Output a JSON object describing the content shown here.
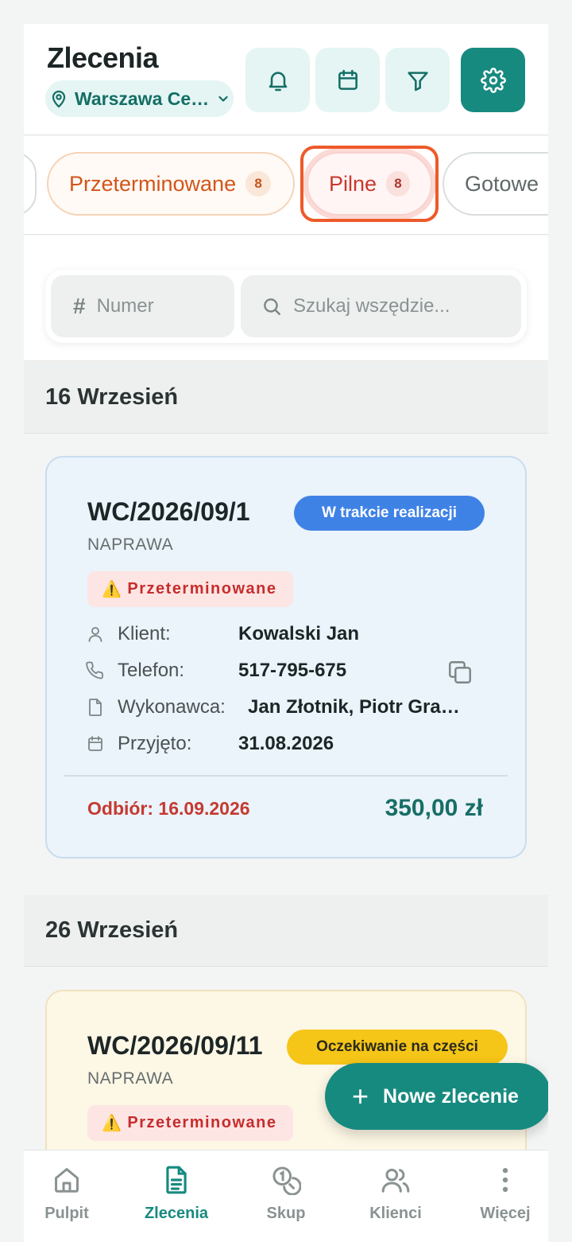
{
  "header": {
    "title": "Zlecenia",
    "location": "Warszawa Ce…",
    "icons": [
      "bell-icon",
      "calendar-icon",
      "filter-icon",
      "gear-icon"
    ]
  },
  "tabs": {
    "overdue": {
      "label": "Przeterminowane",
      "count": "8"
    },
    "urgent": {
      "label": "Pilne",
      "count": "8"
    },
    "ready": {
      "label": "Gotowe"
    }
  },
  "search": {
    "number_placeholder": "Numer",
    "search_placeholder": "Szukaj wszędzie..."
  },
  "groups": [
    {
      "date": "16 Wrzesień",
      "orders": [
        {
          "number": "WC/2026/09/1",
          "type": "NAPRAWA",
          "status": "W trakcie realizacji",
          "flag": "Przeterminowane",
          "client_label": "Klient:",
          "client": "Kowalski Jan",
          "phone_label": "Telefon:",
          "phone": "517-795-675",
          "worker_label": "Wykonawca:",
          "worker": "Jan Złotnik, Piotr Grabowski",
          "received_label": "Przyjęto:",
          "received": "31.08.2026",
          "pickup": "Odbiór: 16.09.2026",
          "price": "350,00 zł"
        }
      ]
    },
    {
      "date": "26 Wrzesień",
      "orders": [
        {
          "number": "WC/2026/09/11",
          "type": "NAPRAWA",
          "status": "Oczekiwanie na części",
          "flag": "Przeterminowane"
        }
      ]
    }
  ],
  "fab": {
    "label": "Nowe zlecenie"
  },
  "nav": [
    {
      "label": "Pulpit",
      "icon": "home-icon"
    },
    {
      "label": "Zlecenia",
      "icon": "document-icon",
      "active": true
    },
    {
      "label": "Skup",
      "icon": "coins-icon"
    },
    {
      "label": "Klienci",
      "icon": "users-icon"
    },
    {
      "label": "Więcej",
      "icon": "more-vertical-icon"
    }
  ],
  "colors": {
    "accent": "#178a80",
    "overdue": "#d4541a",
    "urgent": "#c9382e",
    "status_in_progress": "#3f82e6",
    "status_waiting": "#f5c518",
    "price": "#176e66"
  }
}
